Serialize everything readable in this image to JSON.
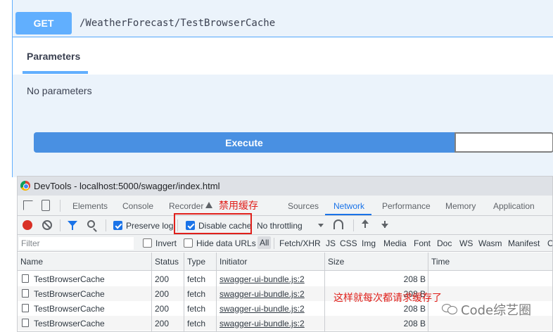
{
  "swagger": {
    "method": "GET",
    "path": "/WeatherForecast/TestBrowserCache",
    "params_tab": "Parameters",
    "no_params": "No parameters",
    "execute_label": "Execute",
    "accent_color": "#61affe",
    "execute_color": "#4990e2"
  },
  "devtools": {
    "window_title": "DevTools - localhost:5000/swagger/index.html",
    "tabs": [
      "Elements",
      "Console",
      "Recorder",
      "Sources",
      "Network",
      "Performance",
      "Memory",
      "Application"
    ],
    "active_tab": "Network",
    "toolbar": {
      "preserve_log": "Preserve log",
      "disable_cache": "Disable cache",
      "throttling": "No throttling"
    },
    "filterbar": {
      "filter_placeholder": "Filter",
      "invert": "Invert",
      "hide_data_urls": "Hide data URLs",
      "types": [
        "All",
        "Fetch/XHR",
        "JS",
        "CSS",
        "Img",
        "Media",
        "Font",
        "Doc",
        "WS",
        "Wasm",
        "Manifest",
        "O"
      ]
    },
    "columns": [
      "Name",
      "Status",
      "Type",
      "Initiator",
      "Size",
      "Time"
    ],
    "rows": [
      {
        "name": "TestBrowserCache",
        "status": "200",
        "type": "fetch",
        "initiator": "swagger-ui-bundle.js:2",
        "size": "208 B"
      },
      {
        "name": "TestBrowserCache",
        "status": "200",
        "type": "fetch",
        "initiator": "swagger-ui-bundle.js:2",
        "size": "208 B"
      },
      {
        "name": "TestBrowserCache",
        "status": "200",
        "type": "fetch",
        "initiator": "swagger-ui-bundle.js:2",
        "size": "208 B"
      },
      {
        "name": "TestBrowserCache",
        "status": "200",
        "type": "fetch",
        "initiator": "swagger-ui-bundle.js:2",
        "size": "208 B"
      }
    ]
  },
  "annotations": {
    "disable_cache_note": "禁用缓存",
    "every_request_note": "这样就每次都请求缓存了",
    "watermark": "Code综艺圈"
  }
}
